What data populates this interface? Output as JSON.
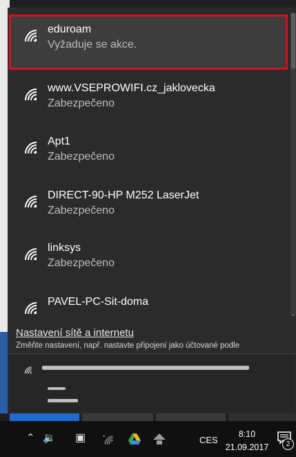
{
  "networks": [
    {
      "name": "eduroam",
      "status": "Vyžaduje se akce."
    },
    {
      "name": "www.VSEPROWIFI.cz_jaklovecka",
      "status": "Zabezpečeno"
    },
    {
      "name": "Apt1",
      "status": "Zabezpečeno"
    },
    {
      "name": "DIRECT-90-HP M252 LaserJet",
      "status": "Zabezpečeno"
    },
    {
      "name": "linksys",
      "status": "Zabezpečeno"
    },
    {
      "name": "PAVEL-PC-Sit-doma",
      "status": ""
    }
  ],
  "settings": {
    "link": "Nastavení sítě a internetu",
    "description": "Změňte nastavení, např. nastavte připojení jako účtované podle"
  },
  "taskbar": {
    "language": "CES",
    "time": "8:10",
    "date": "21.09.2017",
    "notification_count": "2"
  },
  "colors": {
    "selection_border": "#d1131f",
    "flyout_bg": "#2b2b2b",
    "taskbar_bg": "#101010"
  },
  "icons": [
    "wifi-icon",
    "chevron-up-icon",
    "volume-icon",
    "tablet-mode-icon",
    "wifi-off-icon",
    "google-drive-icon",
    "network-icon",
    "action-center-icon"
  ]
}
